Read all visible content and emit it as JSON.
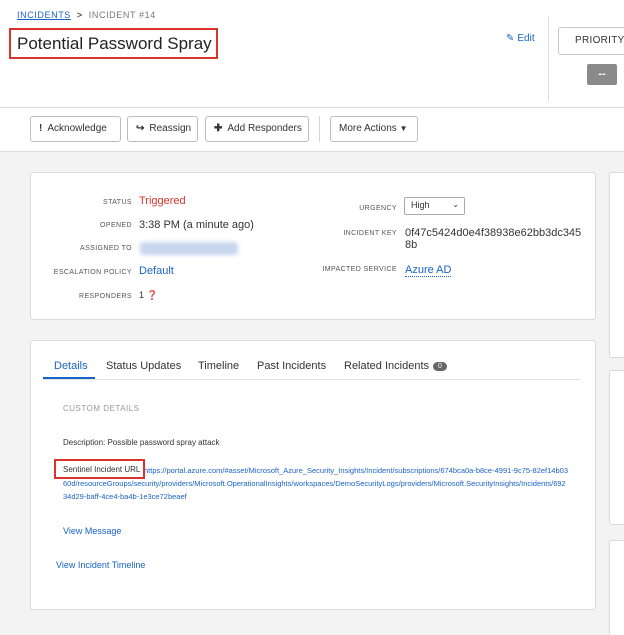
{
  "breadcrumb": {
    "parent": "INCIDENTS",
    "separator": ">",
    "current": "INCIDENT #14"
  },
  "incident": {
    "title": "Potential Password Spray",
    "edit_label": "Edit"
  },
  "priority": {
    "button_label": "PRIORITY",
    "value": "--"
  },
  "toolbar": {
    "acknowledge_icon": "!",
    "acknowledge": "Acknowledge",
    "reassign_icon": "↪",
    "reassign": "Reassign",
    "add_responders_icon": "✚",
    "add_responders": "Add Responders",
    "more_actions": "More Actions"
  },
  "summary": {
    "status_label": "STATUS",
    "status": "Triggered",
    "opened_label": "OPENED",
    "opened": "3:38 PM (a minute ago)",
    "assigned_label": "ASSIGNED TO",
    "escalation_label": "ESCALATION POLICY",
    "escalation": "Default",
    "responders_label": "RESPONDERS",
    "responders": "1",
    "urgency_label": "URGENCY",
    "urgency": "High",
    "incident_key_label": "INCIDENT KEY",
    "incident_key": "0f47c5424d0e4f38938e62bb3dc3458b",
    "impacted_service_label": "IMPACTED SERVICE",
    "impacted_service": "Azure AD"
  },
  "tabs": [
    {
      "label": "Details",
      "active": true
    },
    {
      "label": "Status Updates"
    },
    {
      "label": "Timeline"
    },
    {
      "label": "Past Incidents"
    },
    {
      "label": "Related Incidents",
      "badge": "0"
    }
  ],
  "details": {
    "custom_header": "CUSTOM DETAILS",
    "description": "Description: Possible password spray attack",
    "sentinel_label": "Sentinel Incident URL",
    "sentinel_url": "https://portal.azure.com/#asset/Microsoft_Azure_Security_Insights/Incident/subscriptions/674bca0a-b8ce-4991-9c75-82ef14b0360d/resourceGroups/security/providers/Microsoft.OperationalInsights/workspaces/DemoSecurityLogs/providers/Microsoft.SecurityInsights/Incidents/69234d29-baff-4ce4-ba4b-1e3ce72beaef",
    "view_message": "View Message",
    "view_timeline": "View Incident Timeline"
  },
  "colors": {
    "accent": "#1a63c6",
    "triggered": "#d9342b",
    "highlight": "#d9342b"
  }
}
